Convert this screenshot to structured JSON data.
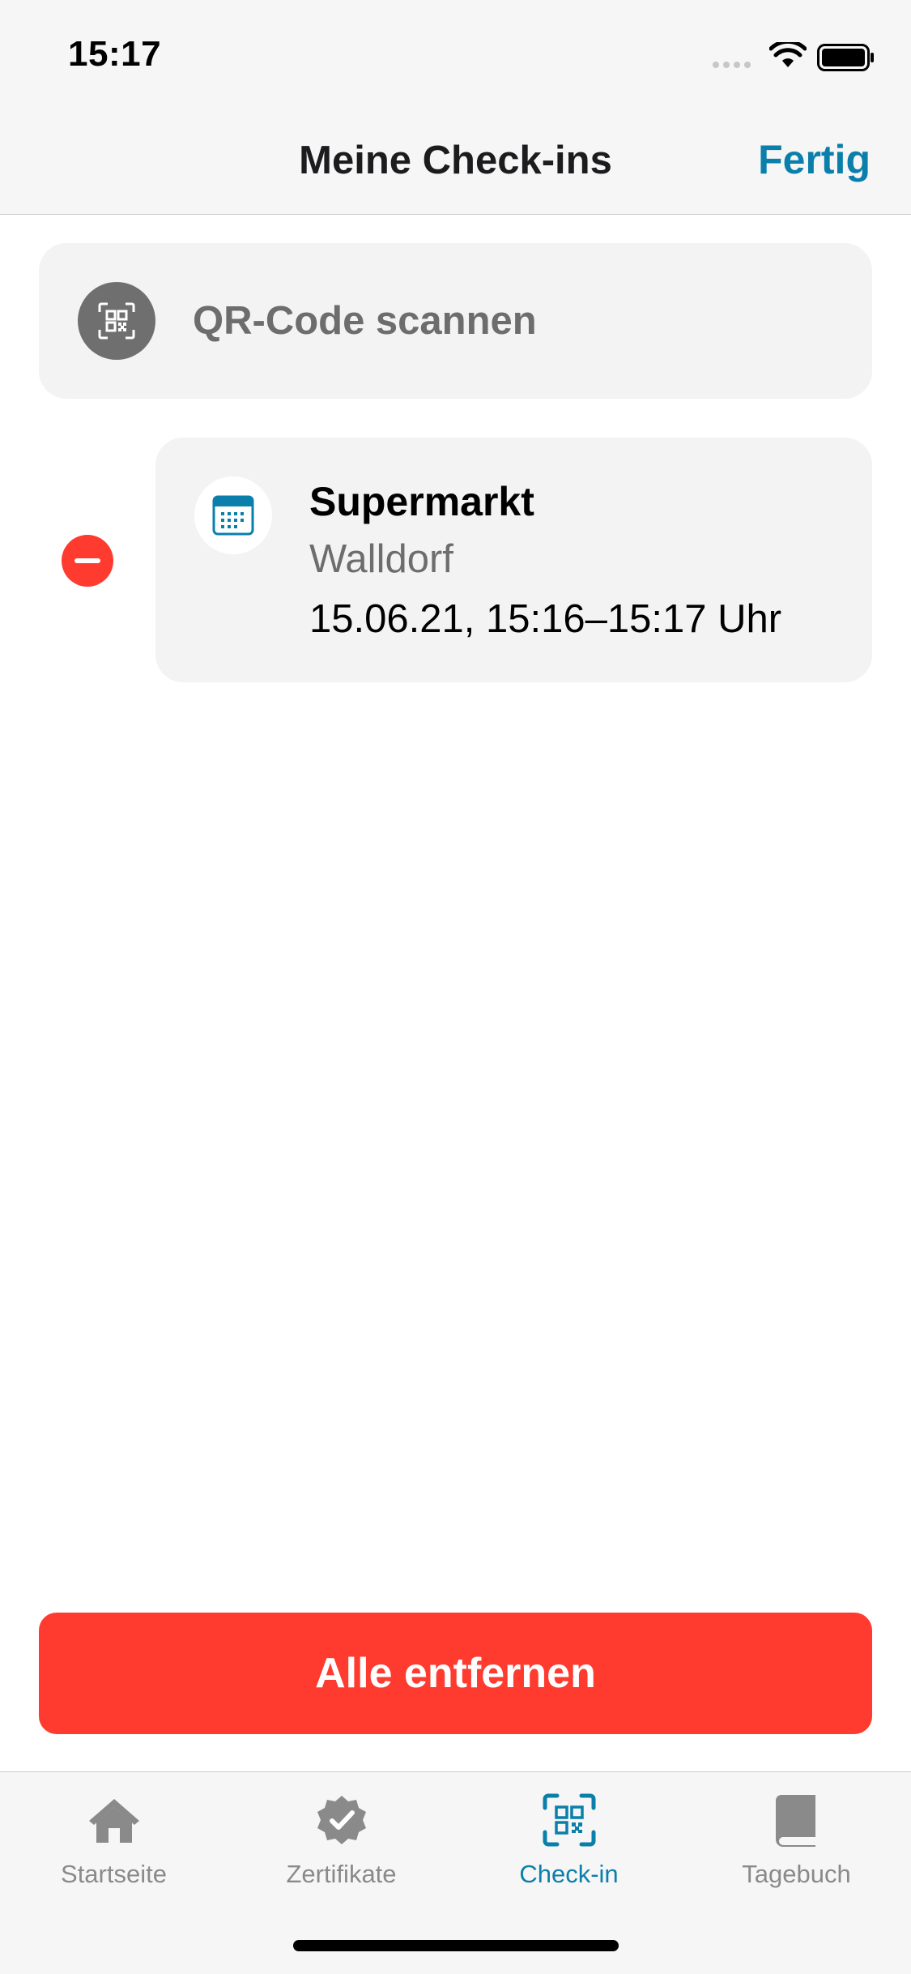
{
  "status_bar": {
    "time": "15:17"
  },
  "nav": {
    "title": "Meine Check-ins",
    "done_label": "Fertig"
  },
  "scan": {
    "label": "QR-Code scannen",
    "icon": "qr-code-icon"
  },
  "checkins": [
    {
      "name": "Supermarkt",
      "location": "Walldorf",
      "time": "15.06.21, 15:16–15:17 Uhr",
      "icon": "calendar-icon"
    }
  ],
  "actions": {
    "remove_all_label": "Alle entfernen"
  },
  "tabs": [
    {
      "label": "Startseite",
      "icon": "house-icon",
      "active": false
    },
    {
      "label": "Zertifikate",
      "icon": "certificate-badge-icon",
      "active": false
    },
    {
      "label": "Check-in",
      "icon": "qr-scan-icon",
      "active": true
    },
    {
      "label": "Tagebuch",
      "icon": "book-icon",
      "active": false
    }
  ],
  "colors": {
    "accent": "#0b7fab",
    "destructive": "#ff3b30",
    "cell_background": "#f3f3f3",
    "secondary_text": "#6d6d6d"
  }
}
